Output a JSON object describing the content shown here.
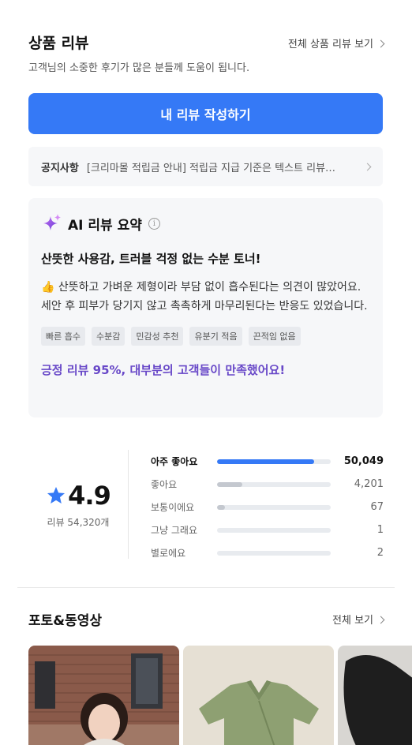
{
  "header": {
    "title": "상품 리뷰",
    "view_all": "전체 상품 리뷰 보기",
    "subtitle": "고객님의 소중한 후기가 많은 분들께 도움이 됩니다."
  },
  "write_button": "내 리뷰 작성하기",
  "notice": {
    "label": "공지사항",
    "text": "[크리마몰 적립금 안내] 적립금 지급 기준은 텍스트 리뷰…"
  },
  "ai_summary": {
    "title": "AI 리뷰 요약",
    "headline": "산뜻한 사용감, 트러블 걱정 없는 수분 토너!",
    "body": "👍 산뜻하고 가벼운 제형이라 부담 없이 흡수된다는 의견이 많았어요. 세안 후 피부가 당기지 않고 촉촉하게 마무리된다는 반응도 있었습니다.",
    "tags": [
      "빠른 흡수",
      "수분감",
      "민감성 추천",
      "유분기 적음",
      "끈적임 없음"
    ],
    "positive_summary": "긍정 리뷰 95%, 대부분의 고객들이 만족했어요!"
  },
  "rating": {
    "score": "4.9",
    "review_count": "리뷰 54,320개",
    "distribution": [
      {
        "label": "아주 좋아요",
        "count": "50,049",
        "fraction": 0.855
      },
      {
        "label": "좋아요",
        "count": "4,201",
        "fraction": 0.22
      },
      {
        "label": "보통이에요",
        "count": "67",
        "fraction": 0.07
      },
      {
        "label": "그냥 그래요",
        "count": "1",
        "fraction": 0.0
      },
      {
        "label": "별로에요",
        "count": "2",
        "fraction": 0.0
      }
    ]
  },
  "photos_section": {
    "title": "포토&동영상",
    "view_all": "전체 보기"
  },
  "colors": {
    "accent": "#3579f6",
    "summary_purple": "#6848c8",
    "star": "#3579f6"
  }
}
